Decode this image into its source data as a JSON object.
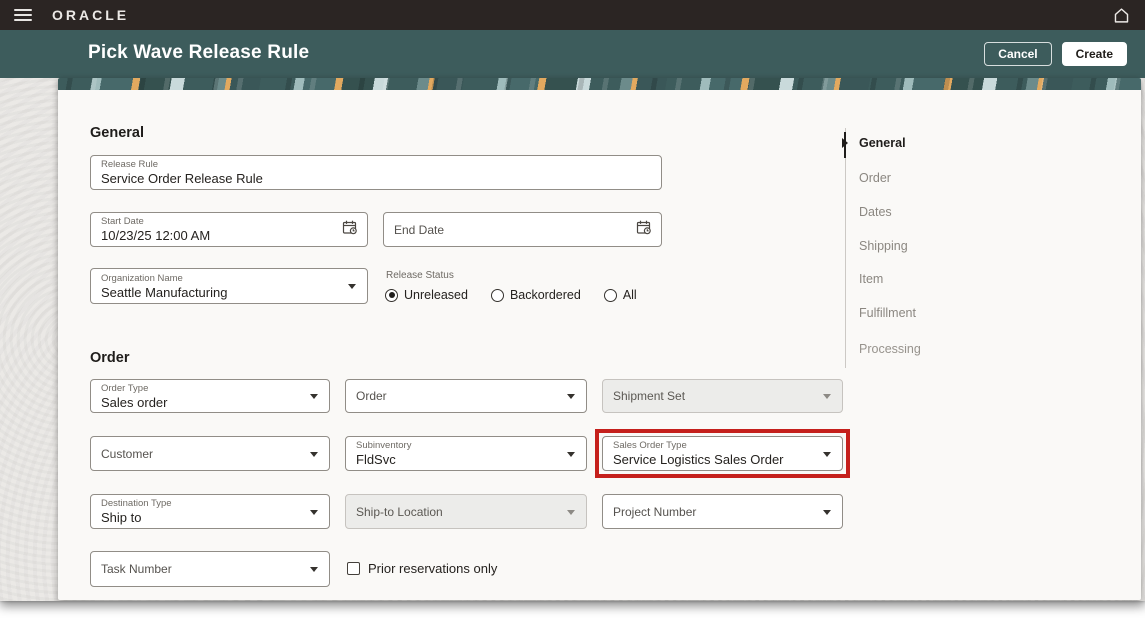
{
  "topbar": {
    "brand": "ORACLE"
  },
  "header": {
    "title": "Pick Wave Release Rule",
    "cancel_label": "Cancel",
    "create_label": "Create"
  },
  "general": {
    "heading": "General",
    "fields": {
      "release_rule": {
        "label": "Release Rule",
        "value": "Service Order Release Rule"
      },
      "start_date": {
        "label": "Start Date",
        "value": "10/23/25 12:00 AM"
      },
      "end_date": {
        "label": "End Date",
        "value": ""
      },
      "organization_name": {
        "label": "Organization Name",
        "value": "Seattle Manufacturing"
      }
    },
    "release_status": {
      "label": "Release Status",
      "options": [
        {
          "label": "Unreleased",
          "selected": true
        },
        {
          "label": "Backordered",
          "selected": false
        },
        {
          "label": "All",
          "selected": false
        }
      ]
    }
  },
  "order": {
    "heading": "Order",
    "fields": {
      "order_type": {
        "label": "Order Type",
        "value": "Sales order"
      },
      "order": {
        "label": "Order",
        "value": ""
      },
      "shipment_set": {
        "label": "Shipment Set",
        "value": "",
        "disabled": true
      },
      "customer": {
        "label": "Customer",
        "value": ""
      },
      "subinventory": {
        "label": "Subinventory",
        "value": "FldSvc"
      },
      "sales_order_type": {
        "label": "Sales Order Type",
        "value": "Service Logistics Sales Order",
        "highlighted": true
      },
      "destination_type": {
        "label": "Destination Type",
        "value": "Ship to"
      },
      "ship_to_location": {
        "label": "Ship-to Location",
        "value": "",
        "disabled": true
      },
      "project_number": {
        "label": "Project Number",
        "value": ""
      },
      "task_number": {
        "label": "Task Number",
        "value": ""
      }
    },
    "prior_reservations_checkbox": {
      "label": "Prior reservations only",
      "checked": false
    }
  },
  "nav": {
    "items": [
      {
        "label": "General",
        "active": true
      },
      {
        "label": "Order",
        "active": false
      },
      {
        "label": "Dates",
        "active": false
      },
      {
        "label": "Shipping",
        "active": false
      },
      {
        "label": "Item",
        "active": false
      },
      {
        "label": "Fulfillment",
        "active": false
      },
      {
        "label": "Processing",
        "active": false
      }
    ]
  },
  "colors": {
    "topbar": "#2B2523",
    "accent_teal": "#3D5C5C",
    "highlight_red": "#C5201C",
    "card_background": "#FAF9F7"
  }
}
